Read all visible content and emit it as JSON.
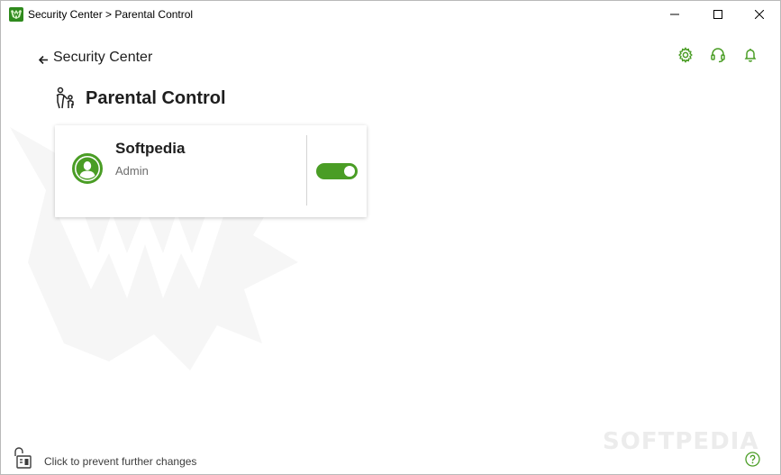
{
  "window": {
    "title": "Security Center > Parental Control",
    "controls": [
      "minimize-icon",
      "maximize-icon",
      "close-icon"
    ]
  },
  "nav": {
    "back_label": "Security Center",
    "back_icon": "arrow-left-icon"
  },
  "toolbar": {
    "icons": [
      "gear-icon",
      "headset-icon",
      "bell-icon"
    ]
  },
  "page": {
    "title": "Parental Control",
    "title_icon": "family-icon"
  },
  "users": [
    {
      "name": "Softpedia",
      "role": "Admin",
      "avatar_icon": "user-avatar-icon",
      "enabled": true
    }
  ],
  "footer": {
    "lock_text": "Click to prevent further changes",
    "lock_icon": "lock-open-icon",
    "help_icon": "help-icon"
  },
  "watermark_text": "SOFTPEDIA",
  "colors": {
    "accent": "#4a9d25",
    "text": "#1e1e1e",
    "muted": "#6e6e6e",
    "watermark": "#ececec"
  }
}
